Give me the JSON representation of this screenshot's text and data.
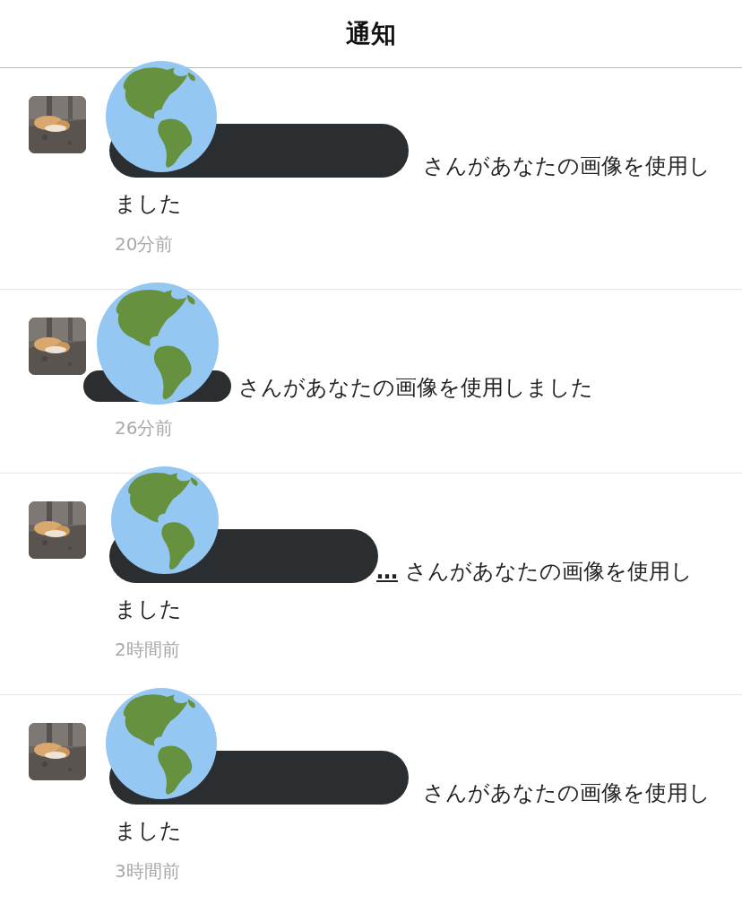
{
  "header": {
    "title": "通知"
  },
  "notifications": [
    {
      "kind": "wide",
      "message": "さんがあなたの画像を使用しました",
      "time": "20分前"
    },
    {
      "kind": "narrow",
      "message": "さんがあなたの画像を使用しました",
      "time": "26分前"
    },
    {
      "kind": "clipped",
      "name_tail": "…",
      "message": "さんがあなたの画像を使用しました",
      "time": "2時間前"
    },
    {
      "kind": "wide",
      "message": "さんがあなたの画像を使用しました",
      "time": "3時間前"
    }
  ]
}
